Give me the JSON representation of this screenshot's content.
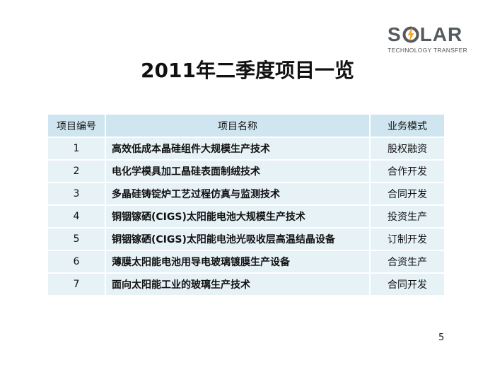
{
  "logo": {
    "letter_s": "S",
    "letters_rest": "LAR",
    "tagline": "TECHNOLOGY TRANSFER",
    "colors": {
      "text": "#555a5e",
      "ring": "#555a5e",
      "bolt": "#f5a623"
    }
  },
  "title": "2011年二季度项目一览",
  "table": {
    "headers": [
      "项目编号",
      "项目名称",
      "业务模式"
    ],
    "rows": [
      {
        "num": "1",
        "name": "高效低成本晶硅组件大规模生产技术",
        "mode": "股权融资"
      },
      {
        "num": "2",
        "name": "电化学模具加工晶硅表面制绒技术",
        "mode": "合作开发"
      },
      {
        "num": "3",
        "name": "多晶硅铸锭炉工艺过程仿真与监测技术",
        "mode": "合同开发"
      },
      {
        "num": "4",
        "name": "铜铟镓硒(CIGS)太阳能电池大规模生产技术",
        "mode": "投资生产"
      },
      {
        "num": "5",
        "name": "铜铟镓硒(CIGS)太阳能电池光吸收层高温结晶设备",
        "mode": "订制开发"
      },
      {
        "num": "6",
        "name": "薄膜太阳能电池用导电玻璃镀膜生产设备",
        "mode": "合资生产"
      },
      {
        "num": "7",
        "name": "面向太阳能工业的玻璃生产技术",
        "mode": "合同开发"
      }
    ],
    "colors": {
      "header_bg": "#cfe5ef",
      "row_bg": "#e7f2f7"
    }
  },
  "page_number": "5"
}
